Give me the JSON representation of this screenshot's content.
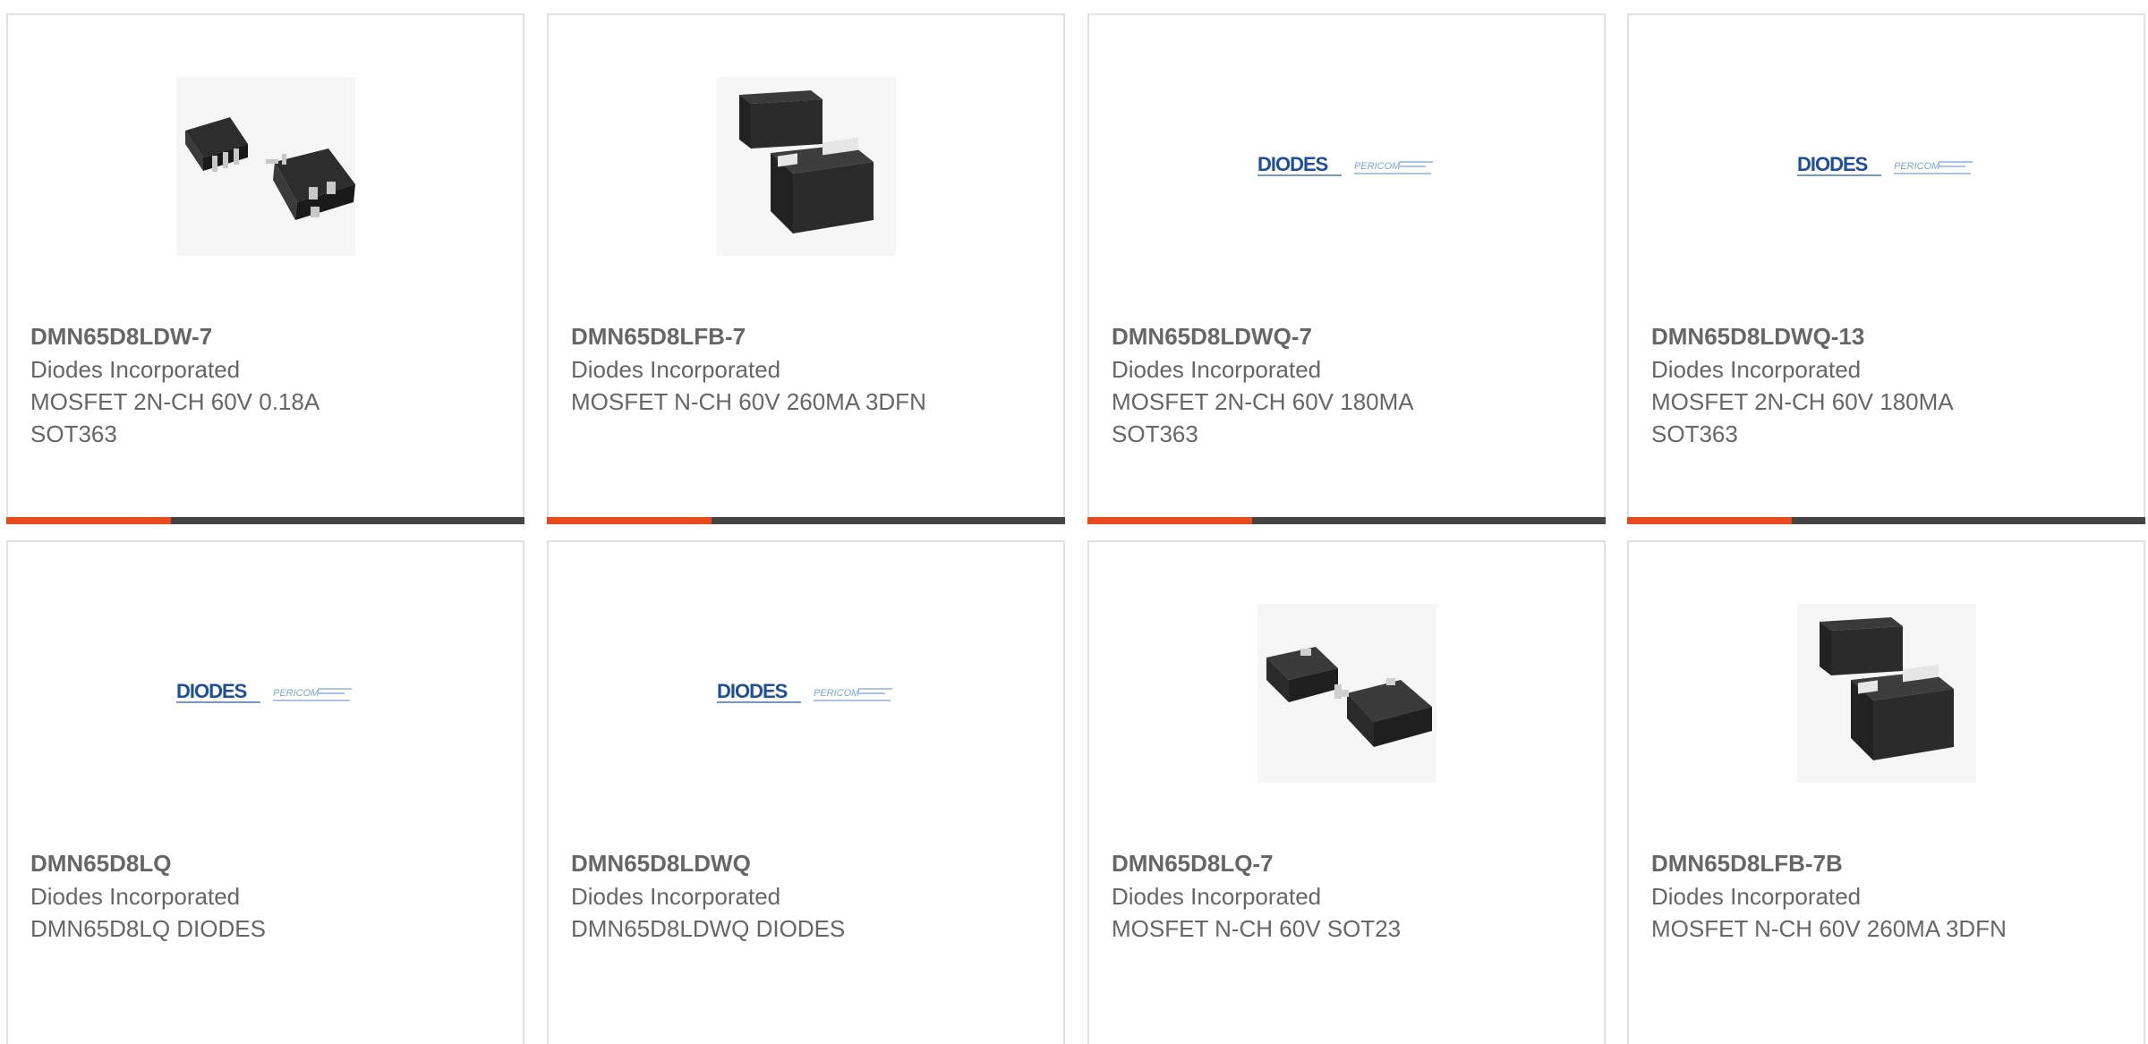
{
  "colors": {
    "accent": "#e84a1b",
    "bar": "#444444",
    "text": "#666666",
    "border": "#e1e1e1",
    "diodes_blue": "#1f4e9c",
    "pericom_blue": "#7ca6d6"
  },
  "products": [
    {
      "part_number": "DMN65D8LDW-7",
      "manufacturer": "Diodes Incorporated",
      "description": "MOSFET 2N-CH 60V 0.18A SOT363",
      "image": "sot363-package-icon"
    },
    {
      "part_number": "DMN65D8LFB-7",
      "manufacturer": "Diodes Incorporated",
      "description": "MOSFET N-CH 60V 260MA 3DFN",
      "image": "dfn-package-icon"
    },
    {
      "part_number": "DMN65D8LDWQ-7",
      "manufacturer": "Diodes Incorporated",
      "description": "MOSFET 2N-CH 60V 180MA SOT363",
      "image": "diodes-pericom-logo"
    },
    {
      "part_number": "DMN65D8LDWQ-13",
      "manufacturer": "Diodes Incorporated",
      "description": "MOSFET 2N-CH 60V 180MA SOT363",
      "image": "diodes-pericom-logo"
    },
    {
      "part_number": "DMN65D8LQ",
      "manufacturer": "Diodes Incorporated",
      "description": "DMN65D8LQ DIODES",
      "image": "diodes-pericom-logo"
    },
    {
      "part_number": "DMN65D8LDWQ",
      "manufacturer": "Diodes Incorporated",
      "description": "DMN65D8LDWQ DIODES",
      "image": "diodes-pericom-logo"
    },
    {
      "part_number": "DMN65D8LQ-7",
      "manufacturer": "Diodes Incorporated",
      "description": "MOSFET N-CH 60V SOT23",
      "image": "sot23-package-icon"
    },
    {
      "part_number": "DMN65D8LFB-7B",
      "manufacturer": "Diodes Incorporated",
      "description": "MOSFET N-CH 60V 260MA 3DFN",
      "image": "dfn-package-icon"
    }
  ],
  "logo_text": {
    "diodes": "DIODES",
    "pericom": "PERICOM"
  }
}
